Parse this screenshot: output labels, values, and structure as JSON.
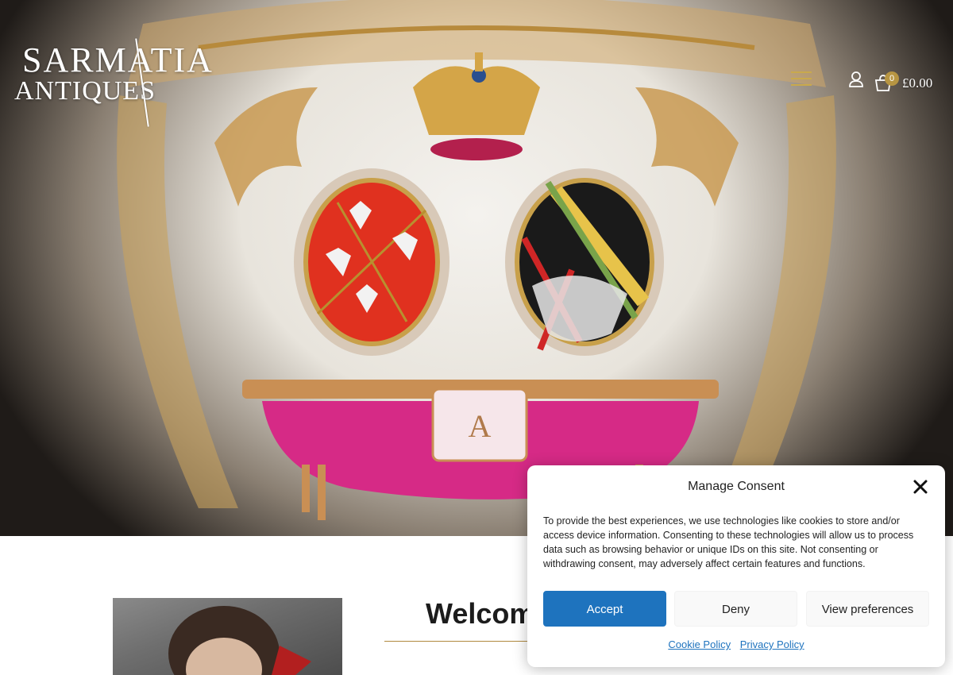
{
  "header": {
    "logo_line1": "SARMATIA",
    "logo_line2": "ANTIQUES",
    "cart_count": "0",
    "cart_total": "£0.00",
    "accent_color": "#c9a94c"
  },
  "icons": {
    "menu": "hamburger-icon",
    "account": "user-icon",
    "cart": "basket-icon",
    "close": "close-icon"
  },
  "main": {
    "welcome_heading": "Welcome"
  },
  "consent": {
    "title": "Manage Consent",
    "body": "To provide the best experiences, we use technologies like cookies to store and/or access device information. Consenting to these technologies will allow us to process data such as browsing behavior or unique IDs on this site. Not consenting or withdrawing consent, may adversely affect certain features and functions.",
    "accept_label": "Accept",
    "deny_label": "Deny",
    "preferences_label": "View preferences",
    "cookie_policy_label": "Cookie Policy",
    "privacy_policy_label": "Privacy Policy",
    "accept_color": "#1e73be"
  }
}
